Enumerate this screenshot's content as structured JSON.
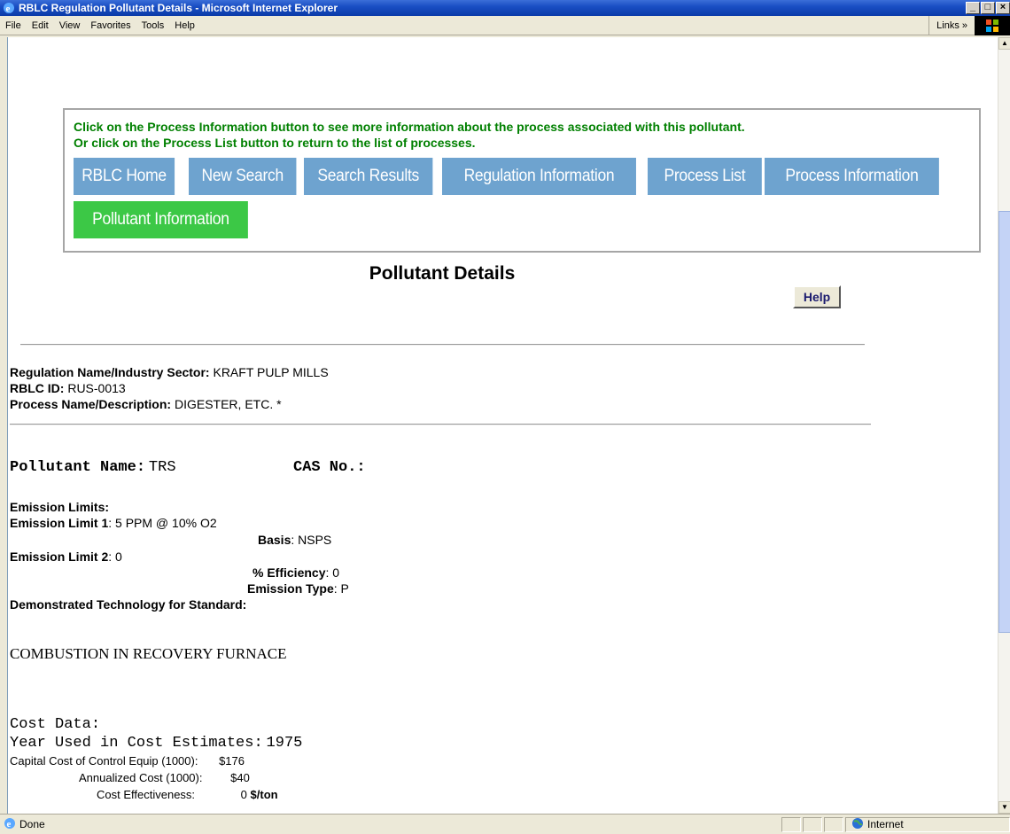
{
  "window": {
    "title": "RBLC Regulation Pollutant Details - Microsoft Internet Explorer",
    "minimize": "_",
    "maximize": "□",
    "close": "×"
  },
  "menu": {
    "items": [
      "File",
      "Edit",
      "View",
      "Favorites",
      "Tools",
      "Help"
    ],
    "links": "Links »"
  },
  "nav": {
    "message_line1": "Click on the Process Information button to see more information about the process associated with this pollutant.",
    "message_line2": "Or click on the Process List button to return to the list of processes.",
    "buttons": [
      "RBLC Home",
      "New Search",
      "Search Results",
      "Regulation Information",
      "Process List",
      "Process Information",
      "Pollutant Information"
    ]
  },
  "page": {
    "title": "Pollutant Details",
    "help": "Help"
  },
  "regulation": {
    "name_label": "Regulation Name/Industry Sector:",
    "name_value": "KRAFT PULP MILLS",
    "id_label": "RBLC ID:",
    "id_value": "RUS-0013",
    "process_label": "Process Name/Description:",
    "process_value": "DIGESTER, ETC. *"
  },
  "pollutant": {
    "name_label": "Pollutant Name:",
    "name_value": "TRS",
    "cas_label": "CAS No.:",
    "cas_value": "",
    "limits_heading": "Emission Limits:",
    "limit1_label": "Emission Limit 1",
    "limit1_value": ": 5 PPM @ 10% O2",
    "basis_label": "Basis",
    "basis_value": ": NSPS",
    "limit2_label": "Emission Limit 2",
    "limit2_value": ": 0",
    "efficiency_label": "% Efficiency",
    "efficiency_value": ": 0",
    "type_label": "Emission Type",
    "type_value": ": P",
    "demo_label": "Demonstrated Technology for Standard:",
    "demo_value": "COMBUSTION IN RECOVERY FURNACE"
  },
  "cost": {
    "heading": "Cost Data:",
    "year_label": "Year Used in Cost Estimates:",
    "year_value": "1975",
    "capital_label": "Capital Cost of Control Equip (1000):",
    "capital_value": "$176",
    "annual_label": "Annualized Cost (1000):",
    "annual_value": "$40",
    "effect_label": "Cost Effectiveness:",
    "effect_value": "0",
    "effect_unit": "$/ton"
  },
  "status": {
    "text": "Done",
    "zone": "Internet"
  }
}
